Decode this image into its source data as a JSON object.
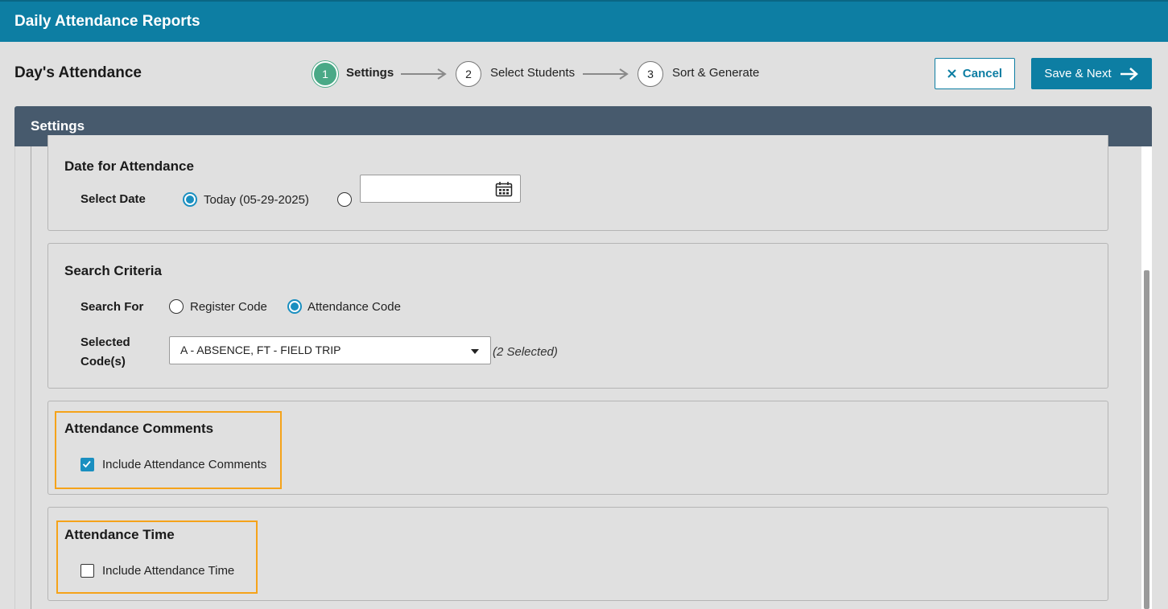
{
  "app": {
    "title": "Daily Attendance Reports"
  },
  "page": {
    "title": "Day's Attendance"
  },
  "steps": [
    {
      "number": "1",
      "label": "Settings",
      "active": true
    },
    {
      "number": "2",
      "label": "Select Students",
      "active": false
    },
    {
      "number": "3",
      "label": "Sort & Generate",
      "active": false
    }
  ],
  "actions": {
    "cancel_label": "Cancel",
    "save_next_label": "Save & Next"
  },
  "panel": {
    "title": "Settings"
  },
  "date_section": {
    "title": "Date for Attendance",
    "field_label": "Select Date",
    "today_option": "Today (05-29-2025)",
    "today_selected": true,
    "custom_date_value": ""
  },
  "search_section": {
    "title": "Search Criteria",
    "search_for_label": "Search For",
    "option_register": "Register Code",
    "option_attendance": "Attendance Code",
    "selected_option": "Attendance Code",
    "codes_label_line1": "Selected",
    "codes_label_line2": "Code(s)",
    "codes_value": "A - ABSENCE, FT - FIELD TRIP",
    "codes_count": "(2 Selected)"
  },
  "comments_section": {
    "title": "Attendance Comments",
    "checkbox_label": "Include Attendance Comments",
    "checked": true
  },
  "time_section": {
    "title": "Attendance Time",
    "checkbox_label": "Include Attendance Time",
    "checked": false
  },
  "colors": {
    "titlebar": "#0d7ea3",
    "panel_header": "#475a6d",
    "step_active": "#4aa987",
    "highlight": "#f5a31a",
    "radio_checked": "#1a8fc0"
  }
}
